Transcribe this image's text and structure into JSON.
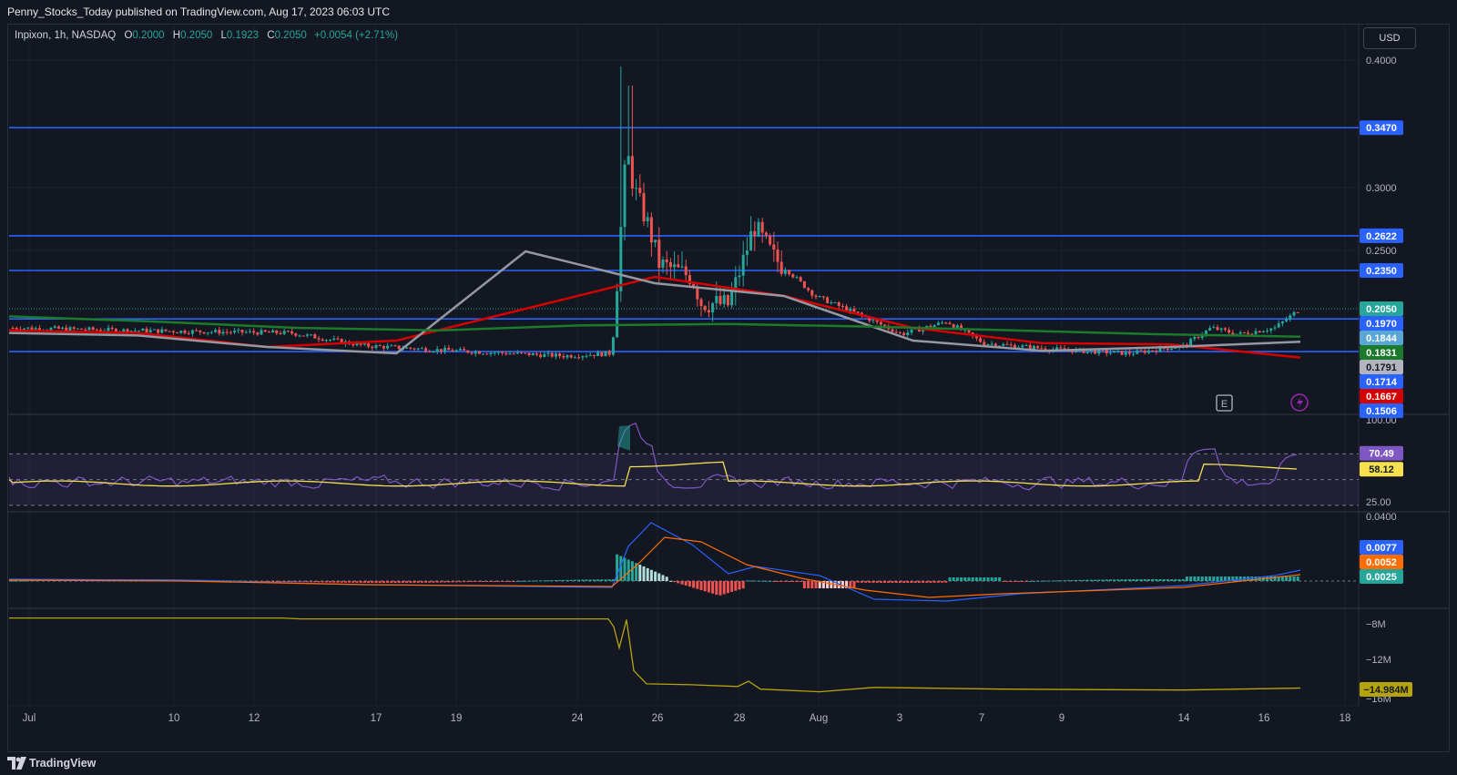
{
  "header": {
    "publisher": "Penny_Stocks_Today published on TradingView.com, Aug 17, 2023 06:03 UTC"
  },
  "legend": {
    "symbol": "Inpixon, 1h, NASDAQ",
    "open_label": "O",
    "open": "0.2000",
    "high_label": "H",
    "high": "0.2050",
    "low_label": "L",
    "low": "0.1923",
    "close_label": "C",
    "close": "0.2050",
    "change": "+0.0054 (+2.71%)"
  },
  "currency_button": "USD",
  "footer": {
    "brand": "TradingView"
  },
  "chart_data": [
    {
      "type": "candlestick",
      "pane": "price",
      "yticks": [
        "0.4000",
        "0.3000",
        "0.2500"
      ],
      "ylim": [
        0.148,
        0.42
      ],
      "horizontal_levels": [
        0.347,
        0.2622,
        0.235,
        0.197,
        0.1714
      ],
      "price_tags": [
        {
          "label": "0.3470",
          "value": 0.347,
          "color": "#2962ff"
        },
        {
          "label": "0.2622",
          "value": 0.2622,
          "color": "#2962ff"
        },
        {
          "label": "0.2350",
          "value": 0.235,
          "color": "#2962ff"
        },
        {
          "label": "0.2050",
          "value": 0.205,
          "color": "#26a69a"
        },
        {
          "label": "0.1970",
          "value": 0.197,
          "color": "#2962ff"
        },
        {
          "label": "0.1844",
          "value": 0.1844,
          "color": "#5aa7d6"
        },
        {
          "label": "0.1831",
          "value": 0.1831,
          "color": "#1b7a2c"
        },
        {
          "label": "0.1791",
          "value": 0.1791,
          "color": "#b2b5be"
        },
        {
          "label": "0.1714",
          "value": 0.1714,
          "color": "#2962ff"
        },
        {
          "label": "0.1667",
          "value": 0.1667,
          "color": "#d50000"
        },
        {
          "label": "0.1506",
          "value": 0.1506,
          "color": "#2962ff"
        }
      ],
      "x_ticks": [
        "Jul",
        "10",
        "12",
        "17",
        "19",
        "24",
        "26",
        "28",
        "Aug",
        "3",
        "7",
        "9",
        "14",
        "16",
        "18"
      ],
      "candles_approx": {
        "start": 0.19,
        "jul24_low": 0.168,
        "spike_high": 0.395,
        "jul25_close": 0.29,
        "jul27_low": 0.205,
        "jul28_high": 0.275,
        "aug9_low": 0.17,
        "last_close": 0.205
      },
      "series": [
        {
          "name": "",
          "color": "#d50000",
          "values": [
            0.188,
            0.186,
            0.175,
            0.18,
            0.205,
            0.23,
            0.215,
            0.19,
            0.178,
            0.177,
            0.1667
          ]
        },
        {
          "name": "",
          "color": "#9598a1",
          "values": [
            0.186,
            0.184,
            0.175,
            0.17,
            0.25,
            0.225,
            0.215,
            0.18,
            0.172,
            0.175,
            0.1791
          ]
        },
        {
          "name": "",
          "color": "#1b7a2c",
          "values": [
            0.199,
            0.195,
            0.19,
            0.188,
            0.192,
            0.193,
            0.191,
            0.188,
            0.185,
            0.1831
          ]
        }
      ]
    },
    {
      "type": "line",
      "pane": "rsi",
      "ylim": [
        25,
        100
      ],
      "yticks": [
        "100.00",
        "25.00"
      ],
      "bands": [
        70,
        50,
        30
      ],
      "price_tags": [
        {
          "label": "70.49",
          "value": 70.49,
          "color": "#7e57c2"
        },
        {
          "label": "58.12",
          "value": 58.12,
          "color": "#f5e050"
        }
      ]
    },
    {
      "type": "bar",
      "pane": "macd",
      "ylim": [
        -0.006,
        0.004
      ],
      "yticks": [
        "0.0400"
      ],
      "price_tags": [
        {
          "label": "0.0077",
          "value": 0.0077,
          "color": "#2962ff"
        },
        {
          "label": "0.0052",
          "value": 0.0052,
          "color": "#ff6d00"
        },
        {
          "label": "0.0025",
          "value": 0.0025,
          "color": "#26a69a"
        }
      ]
    },
    {
      "type": "line",
      "pane": "volume_flow",
      "yticks": [
        "−8M",
        "−12M",
        "−16M"
      ],
      "ylim": [
        -17,
        -6
      ],
      "price_tags": [
        {
          "label": "−14.984M",
          "value": -14.984,
          "color": "#b5a30a"
        }
      ]
    }
  ],
  "colors": {
    "up": "#26a69a",
    "down": "#ef5350",
    "level": "#2962ff",
    "bg": "#131722"
  },
  "icons": {
    "earnings": "E",
    "lightning": "lightning-icon"
  }
}
